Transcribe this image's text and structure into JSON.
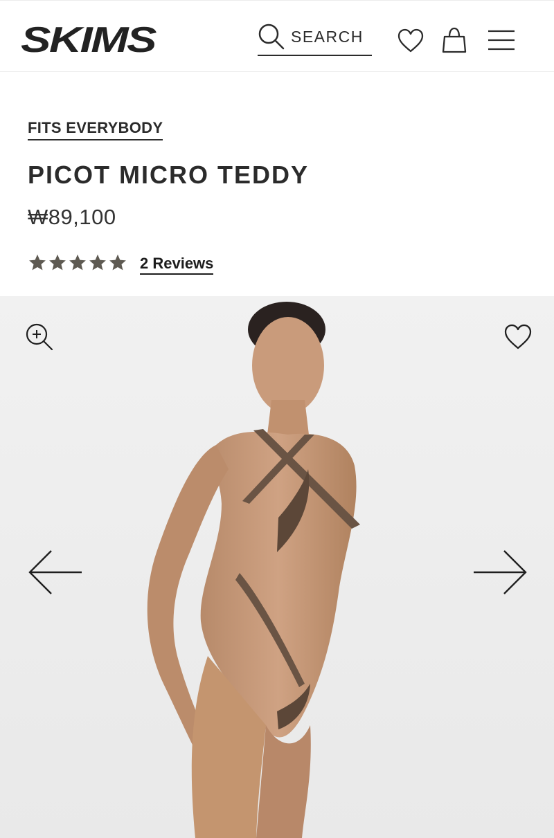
{
  "header": {
    "logo_text": "SKIMS",
    "search_label": "SEARCH",
    "icons": [
      "search-icon",
      "heart-icon",
      "shopping-bag-icon",
      "menu-icon"
    ]
  },
  "product": {
    "collection": "FITS EVERYBODY",
    "name": "PICOT MICRO TEDDY",
    "price": "₩89,100",
    "rating": 5,
    "rating_max": 5,
    "reviews_label": "2 Reviews"
  },
  "gallery": {
    "icons": [
      "zoom-in-icon",
      "heart-icon",
      "arrow-left-icon",
      "arrow-right-icon"
    ]
  },
  "colors": {
    "text": "#2b2b2b",
    "star": "#5e5a52",
    "gallery_bg": "#ececec"
  }
}
